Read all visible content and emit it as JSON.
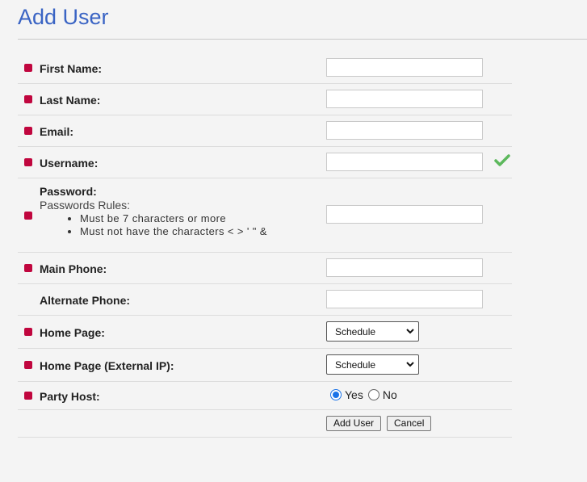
{
  "page": {
    "title": "Add User"
  },
  "fields": {
    "first_name": {
      "label": "First Name:",
      "value": ""
    },
    "last_name": {
      "label": "Last Name:",
      "value": ""
    },
    "email": {
      "label": "Email:",
      "value": ""
    },
    "username": {
      "label": "Username:",
      "value": ""
    },
    "password": {
      "label": "Password:",
      "rules_title": "Passwords Rules:",
      "rules": [
        "Must be 7 characters or more",
        "Must not have the characters < > ' \" &"
      ],
      "value": ""
    },
    "main_phone": {
      "label": "Main Phone:",
      "value": ""
    },
    "alternate_phone": {
      "label": "Alternate Phone:",
      "value": ""
    },
    "home_page": {
      "label": "Home Page:",
      "selected": "Schedule"
    },
    "home_page_external": {
      "label": "Home Page (External IP):",
      "selected": "Schedule"
    },
    "party_host": {
      "label": "Party Host:",
      "options": [
        "Yes",
        "No"
      ],
      "selected": "Yes"
    }
  },
  "buttons": {
    "add_user": "Add User",
    "cancel": "Cancel"
  },
  "colors": {
    "title": "#3a64c4",
    "required_marker": "#c0063e",
    "check": "#5cb85c"
  },
  "icons": {
    "required": "required-marker",
    "valid": "check-icon"
  }
}
